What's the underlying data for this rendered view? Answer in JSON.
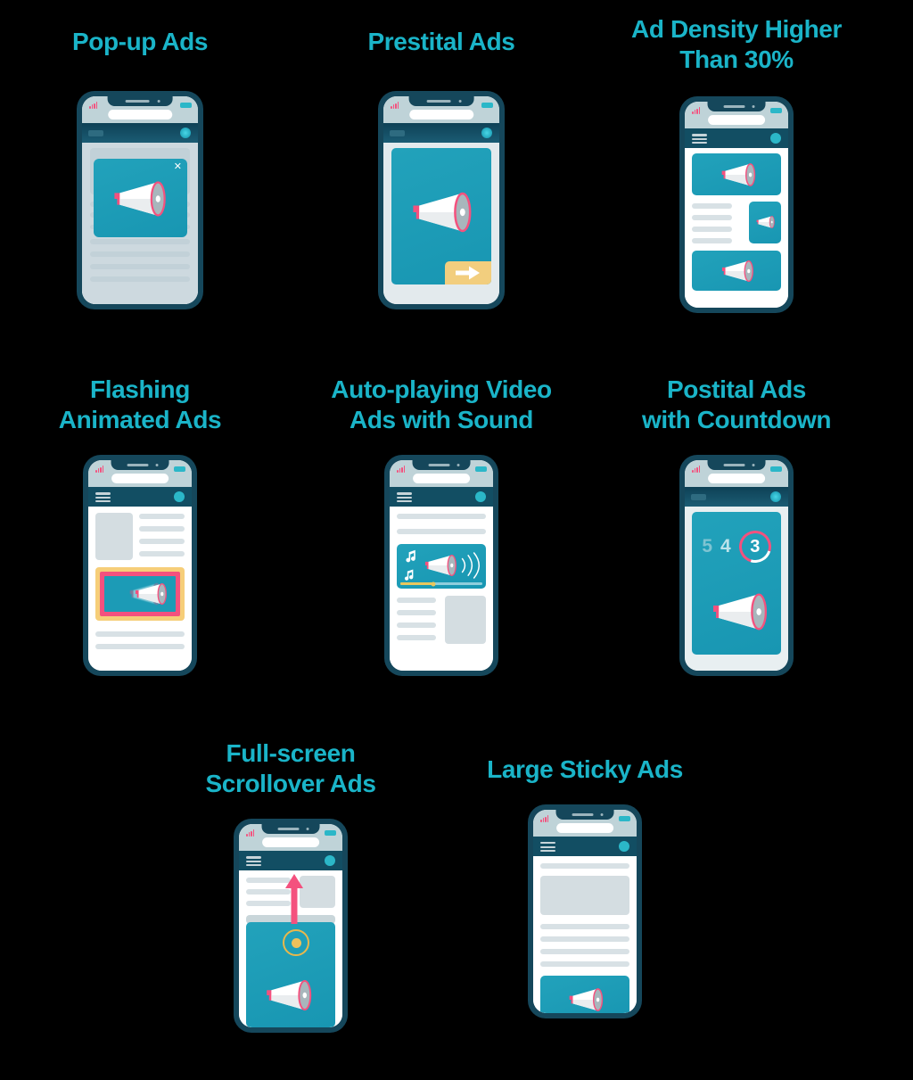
{
  "page": {
    "background_color": "#000000",
    "title_color": "#1AB4C8",
    "accent_teal": "#1E9CB8",
    "accent_pink": "#F4517E",
    "accent_yellow": "#F2CE7E",
    "frame_color": "#15475B",
    "navbar_color": "#124E63"
  },
  "cards": [
    {
      "id": "pop-up-ads",
      "title": "Pop-up Ads",
      "icon": "megaphone-icon",
      "close_label": "✕",
      "phone_variant": "popup-overlay"
    },
    {
      "id": "prestital-ads",
      "title": "Prestital Ads",
      "icon": "megaphone-icon",
      "cta_icon": "arrow-right-icon",
      "phone_variant": "interstitial-before"
    },
    {
      "id": "ad-density-higher-than-30",
      "title": "Ad Density Higher\nThan 30%",
      "icon": "megaphone-icon",
      "phone_variant": "high-ad-density"
    },
    {
      "id": "flashing-animated-ads",
      "title": "Flashing\nAnimated Ads",
      "icon": "megaphone-icon",
      "phone_variant": "flashing-animated"
    },
    {
      "id": "auto-playing-video-ads-with-sound",
      "title": "Auto-playing Video\nAds with Sound",
      "icon": "megaphone-icon",
      "extra_icons": [
        "music-note-icon",
        "sound-wave-icon",
        "progress-bar"
      ],
      "phone_variant": "autoplay-video"
    },
    {
      "id": "postital-ads-with-countdown",
      "title": "Postital Ads\nwith Countdown",
      "icon": "megaphone-icon",
      "countdown": [
        "5",
        "4",
        "3"
      ],
      "phone_variant": "interstitial-countdown"
    },
    {
      "id": "full-screen-scrollover-ads",
      "title": "Full-screen\nScrollover Ads",
      "icon": "megaphone-icon",
      "extra_icons": [
        "arrow-up-icon",
        "touch-point-icon"
      ],
      "phone_variant": "scrollover"
    },
    {
      "id": "large-sticky-ads",
      "title": "Large Sticky Ads",
      "icon": "megaphone-icon",
      "phone_variant": "sticky-bottom"
    }
  ]
}
